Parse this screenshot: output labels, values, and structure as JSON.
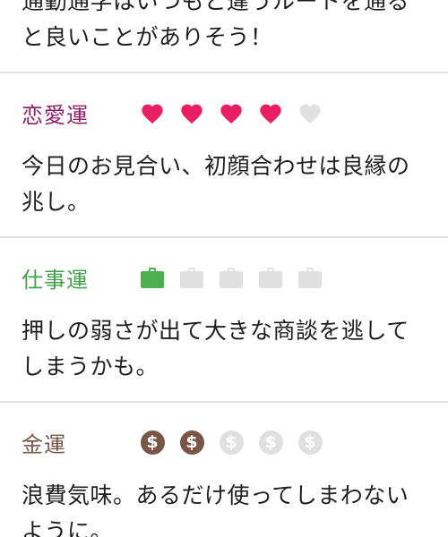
{
  "sections": {
    "general": {
      "desc_line1": "通勤通学はいつもと違うルートを通る",
      "desc_line2": "と良いことがありそう！"
    },
    "love": {
      "title": "恋愛運",
      "rating": 4,
      "max": 5,
      "icon": "heart-icon",
      "desc_line1": "今日のお見合い、初顔合わせは良縁の",
      "desc_line2": "兆し。"
    },
    "work": {
      "title": "仕事運",
      "rating": 1,
      "max": 5,
      "icon": "briefcase-icon",
      "desc_line1": "押しの弱さが出て大きな商談を逃して",
      "desc_line2": "しまうかも。"
    },
    "money": {
      "title": "金運",
      "rating": 2,
      "max": 5,
      "icon": "dollar-coin-icon",
      "coin_symbol": "$",
      "desc_line1": "浪費気味。あるだけ使ってしまわない",
      "desc_line2": "ように。"
    }
  },
  "colors": {
    "love_accent": "#e91e63",
    "work_accent": "#4caf50",
    "money_accent": "#795548",
    "inactive": "#e0e0e0",
    "love_title": "#8e1f6b",
    "work_title": "#43a047",
    "money_title": "#795548",
    "divider": "#dedede"
  }
}
